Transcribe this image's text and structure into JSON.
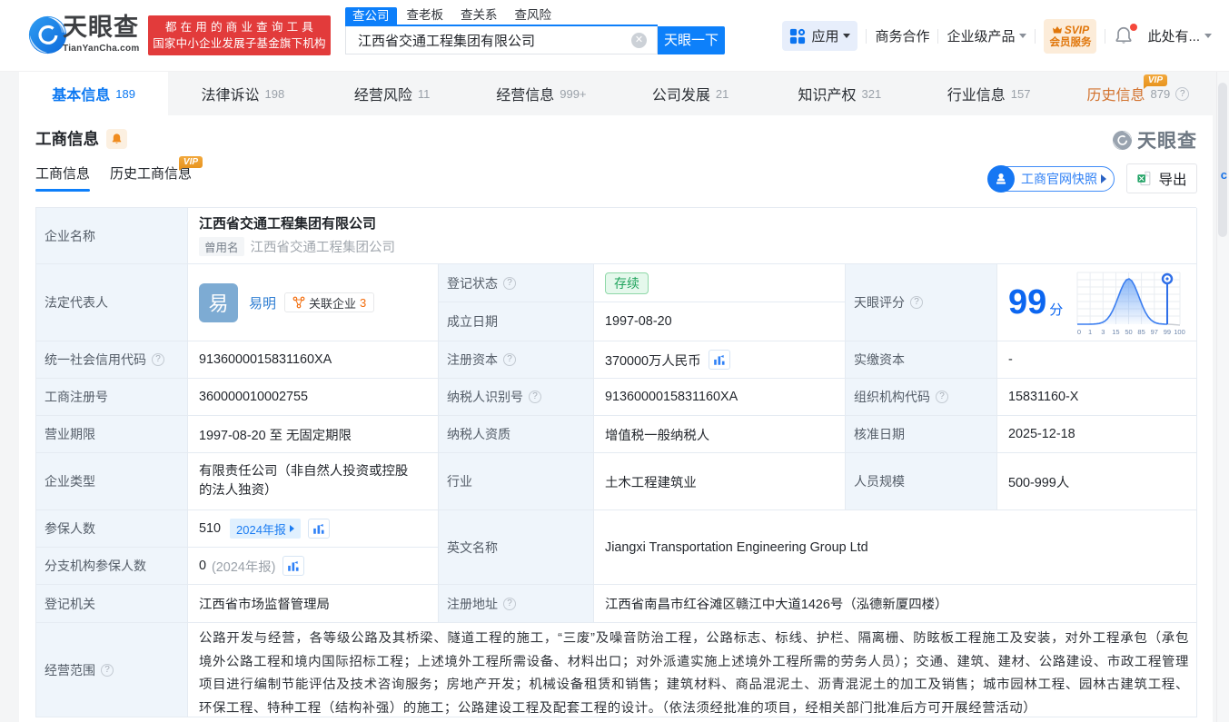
{
  "colors": {
    "brand_blue": "#0d80fa",
    "score_blue": "#0c66f0",
    "status_green": "#20a35c",
    "vip_orange": "#e8941f",
    "slogan_red": "#e23b3b"
  },
  "header": {
    "logo_title": "天眼查",
    "logo_domain": "TianYanCha.com",
    "slogan_line1": "都在用的商业查询工具",
    "slogan_line2": "国家中小企业发展子基金旗下机构",
    "search": {
      "tabs": [
        {
          "label": "查公司"
        },
        {
          "label": "查老板"
        },
        {
          "label": "查关系"
        },
        {
          "label": "查风险"
        }
      ],
      "input_value": "江西省交通工程集团有限公司",
      "button_label": "天眼一下"
    },
    "apps_label": "应用",
    "link_cooperation": "商务合作",
    "link_enterprise": "企业级产品",
    "svip_line1": "SVIP",
    "svip_line2": "会员服务",
    "profile_label": "此处有..."
  },
  "tabbar": {
    "tabs": [
      {
        "label": "基本信息",
        "count": "189"
      },
      {
        "label": "法律诉讼",
        "count": "198"
      },
      {
        "label": "经营风险",
        "count": "11"
      },
      {
        "label": "经营信息",
        "count": "999+"
      },
      {
        "label": "公司发展",
        "count": "21"
      },
      {
        "label": "知识产权",
        "count": "321"
      },
      {
        "label": "行业信息",
        "count": "157"
      },
      {
        "label": "历史信息",
        "count": "879"
      }
    ],
    "vip_badge": "VIP"
  },
  "section": {
    "title": "工商信息",
    "watermark": "天眼查",
    "subtab_current": "工商信息",
    "subtab_history": "历史工商信息",
    "vip_badge": "VIP",
    "snapshot_button": "工商官网快照",
    "export_button": "导出"
  },
  "table": {
    "company_name_label": "企业名称",
    "company_name": "江西省交通工程集团有限公司",
    "former_name_tag": "曾用名",
    "former_name": "江西省交通工程集团公司",
    "legal_rep_label": "法定代表人",
    "legal_rep_avatar": "易",
    "legal_rep_name": "易明",
    "related_label": "关联企业",
    "related_count": "3",
    "reg_status_label": "登记状态",
    "reg_status": "存续",
    "establish_label": "成立日期",
    "establish_date": "1997-08-20",
    "score_label": "天眼评分",
    "score_value": "99",
    "score_unit": "分",
    "credit_code_label": "统一社会信用代码",
    "credit_code": "9136000015831160XA",
    "reg_capital_label": "注册资本",
    "reg_capital": "370000万人民币",
    "paid_capital_label": "实缴资本",
    "paid_capital": "-",
    "reg_number_label": "工商注册号",
    "reg_number": "360000010002755",
    "taxpayer_id_label": "纳税人识别号",
    "taxpayer_id": "9136000015831160XA",
    "org_code_label": "组织机构代码",
    "org_code": "15831160-X",
    "business_term_label": "营业期限",
    "business_term": "1997-08-20 至 无固定期限",
    "taxpayer_quality_label": "纳税人资质",
    "taxpayer_quality": "增值税一般纳税人",
    "approval_date_label": "核准日期",
    "approval_date": "2025-12-18",
    "company_type_label": "企业类型",
    "company_type": "有限责任公司（非自然人投资或控股的法人独资）",
    "industry_label": "行业",
    "industry": "土木工程建筑业",
    "staff_size_label": "人员规模",
    "staff_size": "500-999人",
    "insured_label": "参保人数",
    "insured_count": "510",
    "insured_report": "2024年报",
    "branch_insured_label": "分支机构参保人数",
    "branch_insured_count": "0",
    "branch_insured_report": "(2024年报)",
    "english_name_label": "英文名称",
    "english_name": "Jiangxi Transportation Engineering Group Ltd",
    "reg_authority_label": "登记机关",
    "reg_authority": "江西省市场监督管理局",
    "address_label": "注册地址",
    "address": "江西省南昌市红谷滩区赣江中大道1426号（泓德新厦四楼）",
    "business_scope_label": "经营范围",
    "business_scope": "公路开发与经营，各等级公路及其桥梁、隧道工程的施工，“三废”及噪音防治工程，公路标志、标线、护栏、隔离栅、防眩板工程施工及安装，对外工程承包（承包境外公路工程和境内国际招标工程；上述境外工程所需设备、材料出口；对外派遣实施上述境外工程所需的劳务人员）；交通、建筑、建材、公路建设、市政工程管理项目进行编制节能评估及技术咨询服务；房地产开发；机械设备租赁和销售；建筑材料、商品混泥土、沥青混泥土的加工及销售；城市园林工程、园林古建筑工程、环保工程、特种工程（结构补强）的施工；公路建设工程及配套工程的设计。（依法须经批准的项目，经相关部门批准后方可开展经营活动）"
  },
  "edge_widget": "c",
  "chart_data": {
    "type": "area",
    "title": "天眼评分分布曲线",
    "x_tick_labels": [
      "0",
      "1",
      "3",
      "15",
      "50",
      "85",
      "97",
      "99",
      "100"
    ],
    "marker_value": 99,
    "score": 99,
    "curve_shape": "bell curve peaking at the 50 tick, vertical marker pin at 99",
    "legend_position": "none",
    "grid": true
  }
}
